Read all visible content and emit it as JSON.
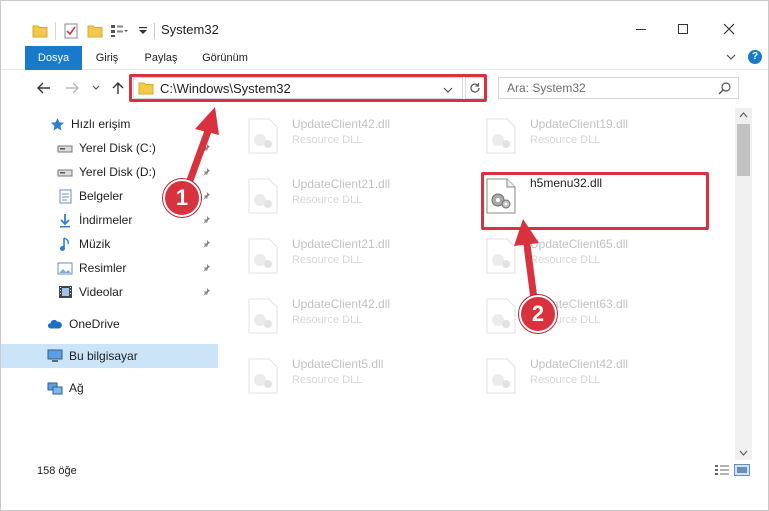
{
  "window": {
    "title": "System32"
  },
  "ribbon": {
    "tabs": [
      {
        "label": "Dosya"
      },
      {
        "label": "Giriş"
      },
      {
        "label": "Paylaş"
      },
      {
        "label": "Görünüm"
      }
    ],
    "help_label": "?"
  },
  "navigation": {
    "address": "C:\\Windows\\System32",
    "search_placeholder": "Ara: System32"
  },
  "sidebar": {
    "items": [
      {
        "label": "Hızlı erişim",
        "icon": "star-icon"
      },
      {
        "label": "Yerel Disk (C:)",
        "icon": "drive-icon",
        "pinned": true
      },
      {
        "label": "Yerel Disk (D:)",
        "icon": "drive-icon",
        "pinned": true
      },
      {
        "label": "Belgeler",
        "icon": "documents-icon",
        "pinned": true
      },
      {
        "label": "İndirmeler",
        "icon": "download-icon",
        "pinned": true
      },
      {
        "label": "Müzik",
        "icon": "music-icon",
        "pinned": true
      },
      {
        "label": "Resimler",
        "icon": "pictures-icon",
        "pinned": true
      },
      {
        "label": "Videolar",
        "icon": "videos-icon",
        "pinned": true
      },
      {
        "label": "OneDrive",
        "icon": "cloud-icon"
      },
      {
        "label": "Bu bilgisayar",
        "icon": "computer-icon",
        "selected": true
      },
      {
        "label": "Ağ",
        "icon": "network-icon"
      }
    ]
  },
  "files": [
    {
      "name": "UpdateClient42.dll",
      "type": "Resource DLL"
    },
    {
      "name": "UpdateClient19.dll",
      "type": "Resource DLL"
    },
    {
      "name": "UpdateClient21.dll",
      "type": "Resource DLL"
    },
    {
      "name": "h5menu32.dll",
      "type": ""
    },
    {
      "name": "UpdateClient21.dll",
      "type": "Resource DLL"
    },
    {
      "name": "UpdateClient65.dll",
      "type": "Resource DLL"
    },
    {
      "name": "UpdateClient42.dll",
      "type": "Resource DLL"
    },
    {
      "name": "UpdateClient63.dll",
      "type": "Resource DLL"
    },
    {
      "name": "UpdateClient5.dll",
      "type": "Resource DLL"
    },
    {
      "name": "UpdateClient42.dll",
      "type": "Resource DLL"
    }
  ],
  "status": {
    "item_count": "158 öğe"
  },
  "annotations": {
    "step1": "1",
    "step2": "2",
    "color": "#d9323f"
  },
  "colors": {
    "accent": "#1979ca",
    "selection": "#cce4f7"
  }
}
